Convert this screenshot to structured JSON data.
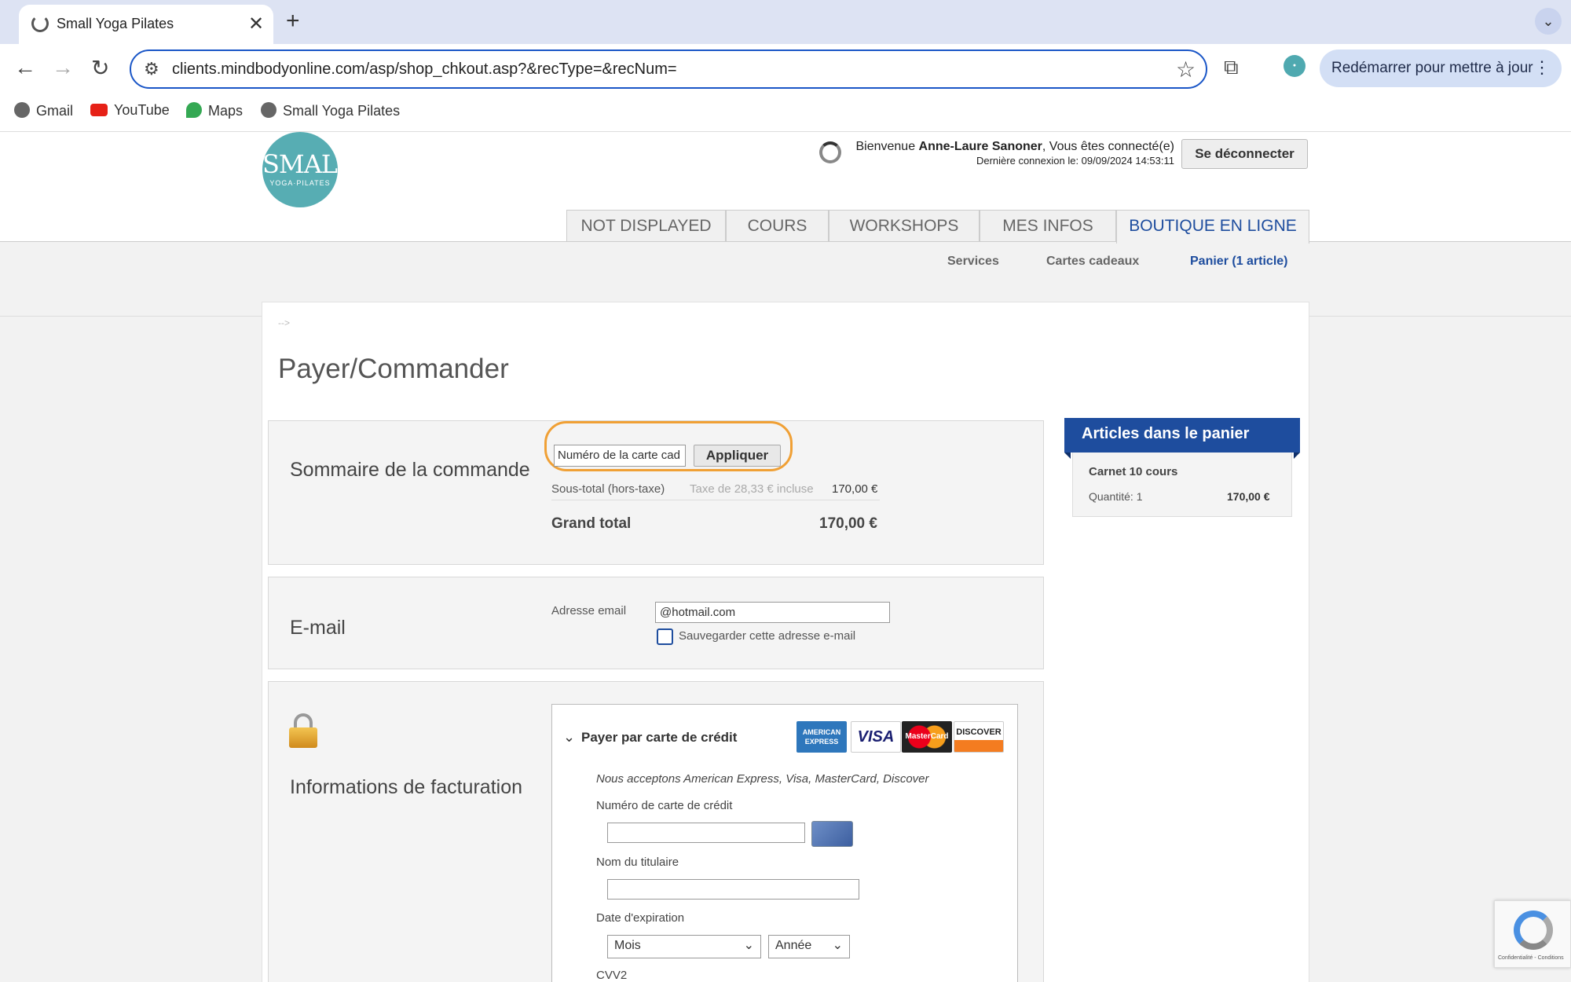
{
  "browser": {
    "tab_title": "Small Yoga Pilates",
    "url": "clients.mindbodyonline.com/asp/shop_chkout.asp?&recType=&recNum=",
    "restart_label": "Redémarrer pour mettre à jour",
    "bookmarks": [
      "Gmail",
      "YouTube",
      "Maps",
      "Small Yoga Pilates"
    ]
  },
  "header": {
    "logo_line1": "SMALL",
    "logo_line2": "YOGA·PILATES",
    "welcome_prefix": "Bienvenue ",
    "user_name": "Anne-Laure Sanoner",
    "welcome_suffix": ", Vous êtes connecté(e)",
    "last_login": "Dernière connexion le: 09/09/2024 14:53:11",
    "logout_label": "Se déconnecter",
    "nav_tabs": [
      "NOT DISPLAYED",
      "COURS",
      "WORKSHOPS",
      "MES INFOS",
      "BOUTIQUE EN LIGNE"
    ],
    "sub_links": [
      "Services",
      "Cartes cadeaux",
      "Panier (1 article)"
    ]
  },
  "page": {
    "breadcrumb": "-->",
    "title": "Payer/Commander"
  },
  "summary": {
    "heading": "Sommaire de la commande",
    "gift_placeholder": "Numéro de la carte cad",
    "apply_label": "Appliquer",
    "subtotal_label": "Sous-total (hors-taxe)",
    "tax_note": "Taxe de 28,33 € incluse",
    "subtotal_value": "170,00 €",
    "grand_total_label": "Grand total",
    "grand_total_value": "170,00 €"
  },
  "email": {
    "heading": "E-mail",
    "label": "Adresse email",
    "value": "@hotmail.com",
    "save_label": "Sauvegarder cette adresse e-mail"
  },
  "billing": {
    "heading": "Informations de facturation",
    "method_label": "Payer par carte de crédit",
    "accepted": "Nous acceptons American Express, Visa, MasterCard, Discover",
    "card_number_label": "Numéro de carte de crédit",
    "holder_label": "Nom du titulaire",
    "expiry_label": "Date d'expiration",
    "month_placeholder": "Mois",
    "year_placeholder": "Année",
    "cvv_label": "CVV2",
    "card_brands": [
      "AMERICAN EXPRESS",
      "VISA",
      "MasterCard",
      "DISCOVER"
    ]
  },
  "cart": {
    "heading": "Articles dans le panier",
    "item_name": "Carnet 10 cours",
    "quantity": "Quantité: 1",
    "price": "170,00 €"
  },
  "recaptcha": {
    "footer": "Confidentialité - Conditions"
  }
}
